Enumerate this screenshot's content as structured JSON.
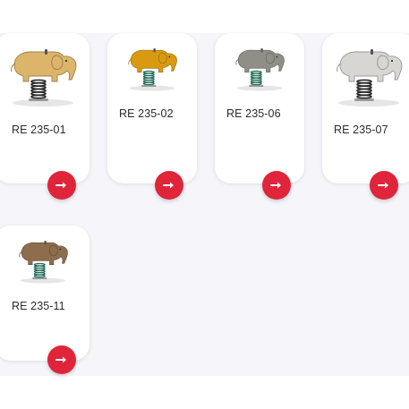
{
  "products": [
    {
      "code": "RE 235-01",
      "color": "#dcb56a",
      "spring": "#2a2a2a",
      "action_icon": "arrow-right-icon"
    },
    {
      "code": "RE 235-02",
      "color": "#d99a12",
      "spring": "#1f6a56",
      "action_icon": "arrow-right-icon"
    },
    {
      "code": "RE 235-06",
      "color": "#8f8f88",
      "spring": "#1f6a56",
      "action_icon": "arrow-right-icon"
    },
    {
      "code": "RE 235-07",
      "color": "#d8d6d2",
      "spring": "#2a2a2a",
      "action_icon": "arrow-right-icon"
    },
    {
      "code": "RE 235-11",
      "color": "#8e6d4e",
      "spring": "#1f6a56",
      "action_icon": "arrow-right-icon"
    }
  ],
  "colors": {
    "accent": "#e0243a",
    "background": "#f5f5fa",
    "card": "#ffffff"
  }
}
